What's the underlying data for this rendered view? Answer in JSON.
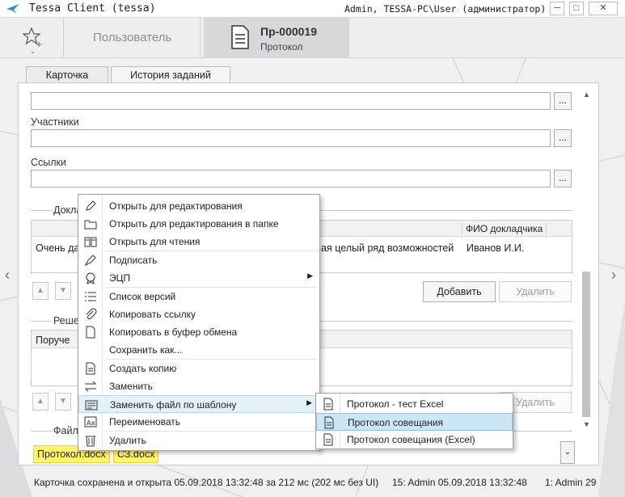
{
  "window": {
    "title": "Tessa Client (tessa)",
    "user": "Admin, TESSA-PC\\User (администратор)",
    "controls": [
      "─",
      "□",
      "✕"
    ]
  },
  "header": {
    "user_tab": "Пользователь",
    "doc_tab": {
      "number": "Пр-000019",
      "type": "Протокол"
    }
  },
  "tabs": [
    "Карточка",
    "История заданий"
  ],
  "form": {
    "participants_label": "Участники",
    "links_label": "Ссылки",
    "dots": "...",
    "reports_label": "Докла",
    "reports_col_speaker": "ФИО докладчика",
    "reports_row": {
      "topic_start": "Очень да",
      "topic_end": "ая целый ряд возможностей",
      "speaker": "Иванов И.И."
    },
    "add_button": "Добавить",
    "delete_button": "Удалить",
    "decisions_label": "Реше",
    "decisions_col": "Поруче",
    "delete_button2": "Удалить",
    "files_label": "Файл",
    "files": [
      "Протокол.docx",
      "СЗ.docx"
    ]
  },
  "context_menu": {
    "items": [
      {
        "label": "Открыть для редактирования",
        "icon": "pencil-icon"
      },
      {
        "label": "Открыть для редактирования в папке",
        "icon": "folder-icon"
      },
      {
        "label": "Открыть для чтения",
        "icon": "book-icon"
      },
      {
        "label": "Подписать",
        "icon": "pen-icon"
      },
      {
        "label": "ЭЦП",
        "icon": "certificate-icon",
        "submenu": true
      },
      {
        "label": "Список версий",
        "icon": "list-icon"
      },
      {
        "label": "Копировать ссылку",
        "icon": "paperclip-icon"
      },
      {
        "label": "Копировать в буфер обмена",
        "icon": "document-icon"
      },
      {
        "label": "Сохранить как...",
        "icon": "none"
      },
      {
        "label": "Создать копию",
        "icon": "copy-icon"
      },
      {
        "label": "Заменить",
        "icon": "swap-icon"
      },
      {
        "label": "Заменить файл по шаблону",
        "icon": "template-icon",
        "submenu": true
      },
      {
        "label": "Переименовать",
        "icon": "rename-icon"
      },
      {
        "label": "Удалить",
        "icon": "trash-icon"
      }
    ],
    "submenu": [
      {
        "label": "Протокол - тест Excel"
      },
      {
        "label": "Протокол совещания"
      },
      {
        "label": "Протокол совещания (Excel)"
      }
    ]
  },
  "status": {
    "message": "Карточка сохранена и открыта 05.09.2018 13:32:48 за 212 мс (202 мс без UI)",
    "second": "15:  Admin  05.09.2018 13:32:48",
    "third": "1:  Admin  29"
  }
}
